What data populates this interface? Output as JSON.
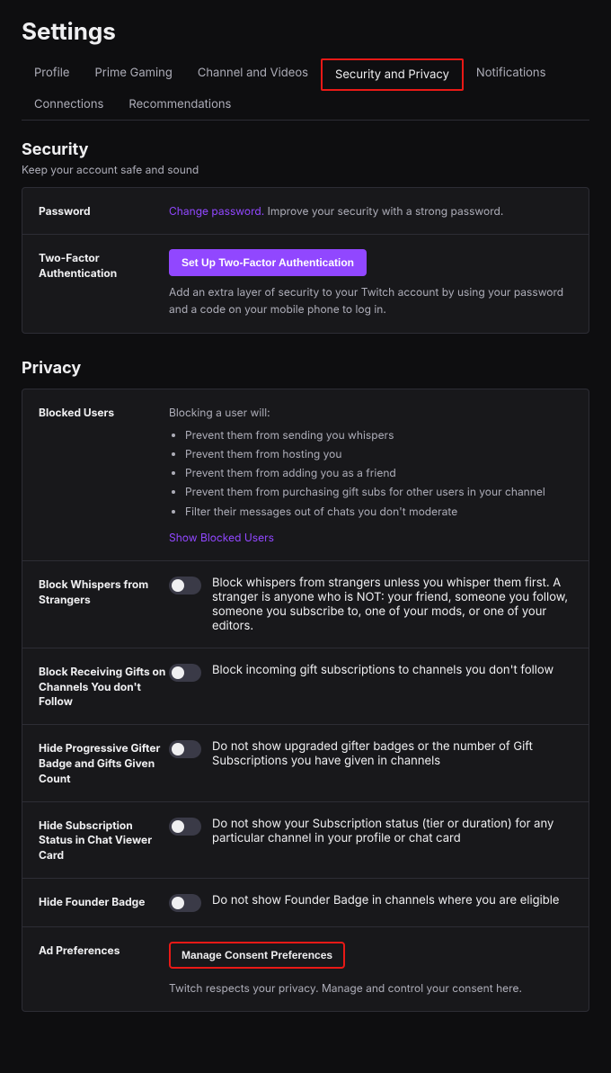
{
  "page": {
    "title": "Settings"
  },
  "nav": {
    "items": [
      {
        "id": "profile",
        "label": "Profile",
        "active": false
      },
      {
        "id": "prime-gaming",
        "label": "Prime Gaming",
        "active": false
      },
      {
        "id": "channel-and-videos",
        "label": "Channel and Videos",
        "active": false
      },
      {
        "id": "security-and-privacy",
        "label": "Security and Privacy",
        "active": true
      },
      {
        "id": "notifications",
        "label": "Notifications",
        "active": false
      },
      {
        "id": "connections",
        "label": "Connections",
        "active": false
      },
      {
        "id": "recommendations",
        "label": "Recommendations",
        "active": false
      }
    ]
  },
  "security_section": {
    "heading": "Security",
    "subheading": "Keep your account safe and sound",
    "rows": [
      {
        "id": "password",
        "label": "Password",
        "link_text": "Change password.",
        "description": " Improve your security with a strong password."
      },
      {
        "id": "two-factor-auth",
        "label": "Two-Factor Authentication",
        "button_label": "Set Up Two-Factor Authentication",
        "description": "Add an extra layer of security to your Twitch account by using your password and a code on your mobile phone to log in."
      }
    ]
  },
  "privacy_section": {
    "heading": "Privacy",
    "rows": [
      {
        "id": "blocked-users",
        "label": "Blocked Users",
        "intro": "Blocking a user will:",
        "list": [
          "Prevent them from sending you whispers",
          "Prevent them from hosting you",
          "Prevent them from adding you as a friend",
          "Prevent them from purchasing gift subs for other users in your channel",
          "Filter their messages out of chats you don't moderate"
        ],
        "link_text": "Show Blocked Users",
        "toggle": null
      },
      {
        "id": "block-whispers",
        "label": "Block Whispers from Strangers",
        "description": "Block whispers from strangers unless you whisper them first. A stranger is anyone who is NOT: your friend, someone you follow, someone you subscribe to, one of your mods, or one of your editors.",
        "toggle": false
      },
      {
        "id": "block-gifts",
        "label": "Block Receiving Gifts on Channels You don't Follow",
        "description": "Block incoming gift subscriptions to channels you don't follow",
        "toggle": false
      },
      {
        "id": "hide-gifter-badge",
        "label": "Hide Progressive Gifter Badge and Gifts Given Count",
        "description": "Do not show upgraded gifter badges or the number of Gift Subscriptions you have given in channels",
        "toggle": false
      },
      {
        "id": "hide-subscription-status",
        "label": "Hide Subscription Status in Chat Viewer Card",
        "description": "Do not show your Subscription status (tier or duration) for any particular channel in your profile or chat card",
        "toggle": false
      },
      {
        "id": "hide-founder-badge",
        "label": "Hide Founder Badge",
        "description": "Do not show Founder Badge in channels where you are eligible",
        "toggle": false
      },
      {
        "id": "ad-preferences",
        "label": "Ad Preferences",
        "button_label": "Manage Consent Preferences",
        "description": "Twitch respects your privacy. Manage and control your consent here.",
        "toggle": null
      }
    ]
  }
}
